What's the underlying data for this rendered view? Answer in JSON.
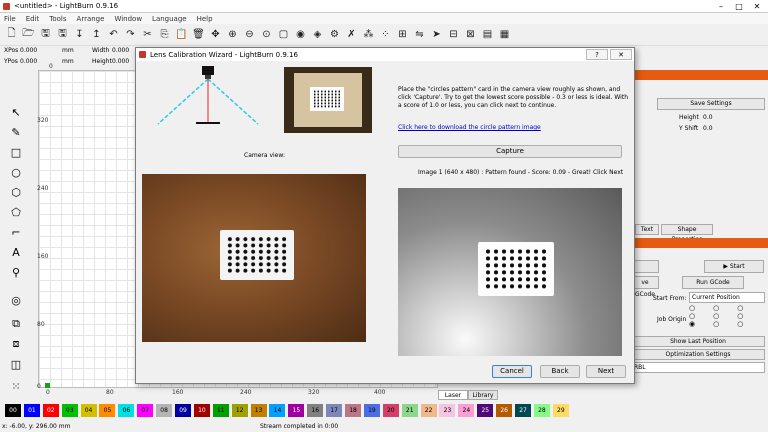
{
  "app": {
    "title": "<untitled> - LightBurn 0.9.16",
    "menu": [
      "File",
      "Edit",
      "Tools",
      "Arrange",
      "Window",
      "Language",
      "Help"
    ]
  },
  "position": {
    "xpos_label": "XPos",
    "xpos_value": "0.000",
    "ypos_label": "YPos",
    "ypos_value": "0.000",
    "unit": "mm",
    "width_label": "Width",
    "width_value": "0.000",
    "height_label": "Height",
    "height_value": "0.000"
  },
  "ruler": {
    "y_ticks": [
      "320",
      "240",
      "160",
      "80",
      "0"
    ],
    "x_ticks": [
      "0",
      "80",
      "160",
      "240",
      "320",
      "400"
    ]
  },
  "right_panel": {
    "save_settings": "Save Settings",
    "height_label": "Height",
    "height_value": "0.0",
    "yshift_label": "Y Shift",
    "yshift_value": "0.0",
    "tab_text": "Text",
    "tab_shape_properties": "Shape Properties",
    "start_label": "Start",
    "save_gcode": "ve GCode",
    "run_gcode": "Run GCode",
    "start_from_label": "Start From:",
    "start_from_value": "Current Position",
    "job_origin_label": "Job Origin",
    "show_last_position": "Show Last Position",
    "optimization_settings": "Optimization Settings",
    "device": "RBL"
  },
  "bottom_tabs": {
    "laser": "Laser",
    "library": "Library"
  },
  "palette": [
    {
      "label": "00",
      "color": "#000000",
      "text": "#ffffff"
    },
    {
      "label": "01",
      "color": "#0000ff",
      "text": "#ffffff"
    },
    {
      "label": "02",
      "color": "#ff0000",
      "text": "#ffffff"
    },
    {
      "label": "03",
      "color": "#00c000",
      "text": "#000000"
    },
    {
      "label": "04",
      "color": "#d2c000",
      "text": "#000000"
    },
    {
      "label": "05",
      "color": "#ff8c00",
      "text": "#000000"
    },
    {
      "label": "06",
      "color": "#00e0e0",
      "text": "#000000"
    },
    {
      "label": "07",
      "color": "#ff00ff",
      "text": "#000000"
    },
    {
      "label": "08",
      "color": "#b4b4b4",
      "text": "#000000"
    },
    {
      "label": "09",
      "color": "#0000a0",
      "text": "#ffffff"
    },
    {
      "label": "10",
      "color": "#a00000",
      "text": "#ffffff"
    },
    {
      "label": "11",
      "color": "#00a000",
      "text": "#000000"
    },
    {
      "label": "12",
      "color": "#a0a000",
      "text": "#000000"
    },
    {
      "label": "13",
      "color": "#c08000",
      "text": "#000000"
    },
    {
      "label": "14",
      "color": "#00a0ff",
      "text": "#000000"
    },
    {
      "label": "15",
      "color": "#a000a0",
      "text": "#ffffff"
    },
    {
      "label": "16",
      "color": "#808080",
      "text": "#000000"
    },
    {
      "label": "17",
      "color": "#7d87b9",
      "text": "#000000"
    },
    {
      "label": "18",
      "color": "#bb7784",
      "text": "#000000"
    },
    {
      "label": "19",
      "color": "#4a6fe3",
      "text": "#000000"
    },
    {
      "label": "20",
      "color": "#d33f6a",
      "text": "#000000"
    },
    {
      "label": "21",
      "color": "#8cd78c",
      "text": "#000000"
    },
    {
      "label": "22",
      "color": "#f0b98d",
      "text": "#000000"
    },
    {
      "label": "23",
      "color": "#f6c4e1",
      "text": "#000000"
    },
    {
      "label": "24",
      "color": "#fa9ed4",
      "text": "#000000"
    },
    {
      "label": "25",
      "color": "#500a78",
      "text": "#ffffff"
    },
    {
      "label": "26",
      "color": "#b45a00",
      "text": "#ffffff"
    },
    {
      "label": "27",
      "color": "#004754",
      "text": "#ffffff"
    },
    {
      "label": "28",
      "color": "#86fa88",
      "text": "#000000"
    },
    {
      "label": "29",
      "color": "#ffdb66",
      "text": "#000000"
    }
  ],
  "status": {
    "coords": "x: -6.00, y: 296.00 mm",
    "message": "Stream completed in 0:00"
  },
  "dialog": {
    "title": "Lens Calibration Wizard - LightBurn 0.9.16",
    "help_button": "?",
    "instructions": "Place the \"circles pattern\" card in the camera view roughly as shown, and click 'Capture'. Try to get the lowest score possible - 0.3 or less is ideal.  With a score of 1.0 or less, you can click next to continue.",
    "download_link": "Click here to download the circle pattern image",
    "camera_view_label": "Camera view:",
    "capture_button": "Capture",
    "result": "Image 1 (640 x 480) : Pattern found - Score: 0.09 - Great! Click Next",
    "cancel_button": "Cancel",
    "back_button": "Back",
    "next_button": "Next"
  },
  "colors": {
    "accent": "#e55b13",
    "link": "#0000cc",
    "dialog_bg": "#f0f0f0"
  }
}
